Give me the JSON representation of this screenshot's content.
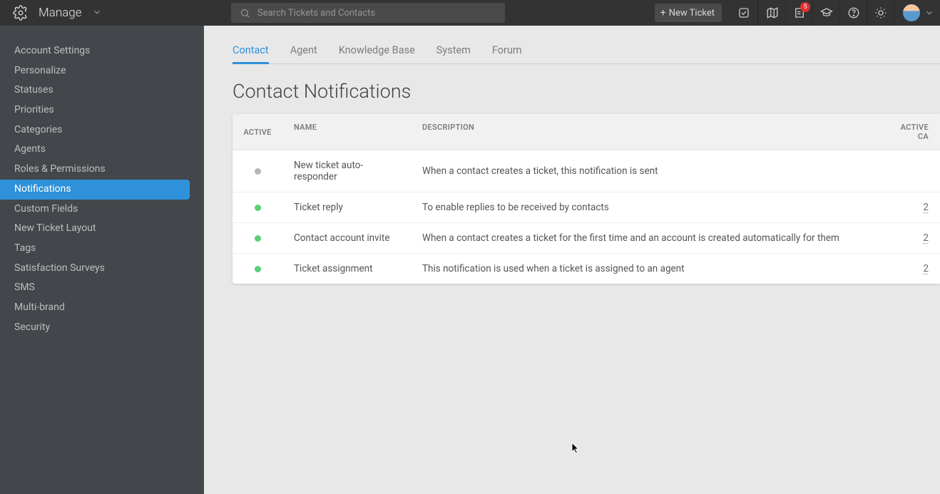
{
  "topbar": {
    "title": "Manage",
    "search_placeholder": "Search Tickets and Contacts",
    "new_ticket_label": "New Ticket",
    "badge_count": "5"
  },
  "sidebar": {
    "items": [
      {
        "label": "Account Settings",
        "active": false
      },
      {
        "label": "Personalize",
        "active": false
      },
      {
        "label": "Statuses",
        "active": false
      },
      {
        "label": "Priorities",
        "active": false
      },
      {
        "label": "Categories",
        "active": false
      },
      {
        "label": "Agents",
        "active": false
      },
      {
        "label": "Roles & Permissions",
        "active": false
      },
      {
        "label": "Notifications",
        "active": true
      },
      {
        "label": "Custom Fields",
        "active": false
      },
      {
        "label": "New Ticket Layout",
        "active": false
      },
      {
        "label": "Tags",
        "active": false
      },
      {
        "label": "Satisfaction Surveys",
        "active": false
      },
      {
        "label": "SMS",
        "active": false
      },
      {
        "label": "Multi-brand",
        "active": false
      },
      {
        "label": "Security",
        "active": false
      }
    ]
  },
  "tabs": [
    {
      "label": "Contact",
      "active": true
    },
    {
      "label": "Agent",
      "active": false
    },
    {
      "label": "Knowledge Base",
      "active": false
    },
    {
      "label": "System",
      "active": false
    },
    {
      "label": "Forum",
      "active": false
    }
  ],
  "page_title": "Contact Notifications",
  "table": {
    "headers": {
      "active": "ACTIVE",
      "name": "NAME",
      "description": "DESCRIPTION",
      "active_cases": "ACTIVE CA"
    },
    "rows": [
      {
        "active": false,
        "name": "New ticket auto-responder",
        "description": "When a contact creates a ticket, this notification is sent",
        "count": ""
      },
      {
        "active": true,
        "name": "Ticket reply",
        "description": "To enable replies to be received by contacts",
        "count": "2"
      },
      {
        "active": true,
        "name": "Contact account invite",
        "description": "When a contact creates a ticket for the first time and an account is created automatically for them",
        "count": "2"
      },
      {
        "active": true,
        "name": "Ticket assignment",
        "description": "This notification is used when a ticket is assigned to an agent",
        "count": "2"
      }
    ]
  }
}
